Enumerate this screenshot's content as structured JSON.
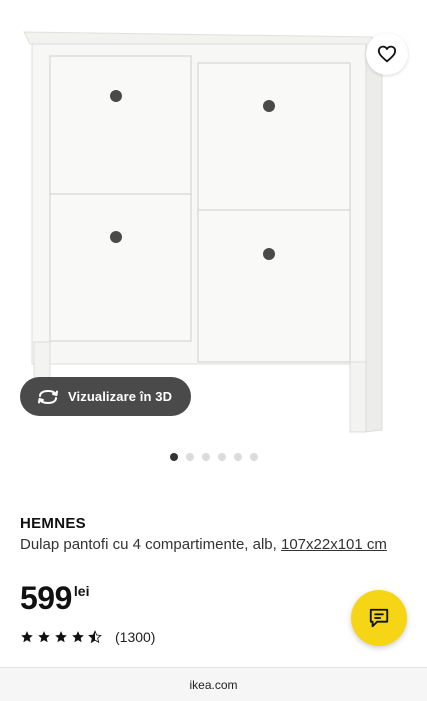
{
  "product": {
    "brand": "HEMNES",
    "description": "Dulap pantofi cu 4 compartimente, alb, ",
    "size": "107x22x101 cm",
    "price": "599",
    "currency": "lei",
    "rating": 4.5,
    "reviews": "(1300)"
  },
  "gallery": {
    "view3d_label": "Vizualizare în 3D",
    "dot_count": 6,
    "active_dot": 0
  },
  "icons": {
    "favorite": "heart-icon",
    "view3d": "rotate-3d-icon",
    "chat": "chat-icon",
    "star": "star-icon"
  },
  "browser": {
    "url": "ikea.com"
  },
  "colors": {
    "chat_button": "#f5d516",
    "view3d_button": "#4a4a4a"
  }
}
